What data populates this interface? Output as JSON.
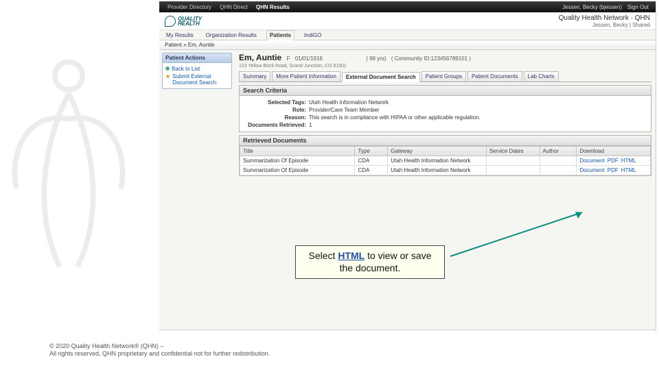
{
  "topnav": {
    "items": [
      "Provider Directory",
      "QHN Direct",
      "QHN Results"
    ],
    "active": 2,
    "user": "Jessen, Becky (bjessen)",
    "signout": "Sign Out"
  },
  "brand": {
    "logo_top": "QUALITY",
    "logo_bot": "HEALTH",
    "right_main": "Quality Health Network · QHN",
    "right_sub": "Jessen, Becky | Shared"
  },
  "tabs": {
    "items": [
      "My Results",
      "Organization Results",
      "Patients",
      "IndiGO"
    ],
    "active": 2
  },
  "breadcrumb": "Patient » Em, Auntie",
  "sidebar": {
    "title": "Patient Actions",
    "back": "Back to List",
    "submit": "Submit External Document Search"
  },
  "patient": {
    "name": "Em, Auntie",
    "sex": "F",
    "dob": "01/01/1916",
    "age": "( 99 yrs)",
    "ctx": "( Community ID:123456789101 )",
    "address": "123 Yellow Brick Road, Grand Junction, CO  81501"
  },
  "detail_tabs": [
    "Summary",
    "More Patient Information",
    "External Document Search",
    "Patient Groups",
    "Patient Documents",
    "Lab Charts"
  ],
  "detail_active": 2,
  "criteria": {
    "title": "Search Criteria",
    "tags_l": "Selected Tags:",
    "tags_v": "Utah Health Information Network",
    "role_l": "Role:",
    "role_v": "Provider/Care Team Member",
    "reason_l": "Reason:",
    "reason_v": "This search is in compliance with HIPAA or other applicable regulation.",
    "docs_l": "Documents Retrieved:",
    "docs_v": "1"
  },
  "retrieved": {
    "title": "Retrieved Documents",
    "cols": [
      "Title",
      "Type",
      "Gateway",
      "Service Dates",
      "Author",
      "Download"
    ],
    "rows": [
      {
        "title": "Summarization Of Episode",
        "type": "CDA",
        "gateway": "Utah Health Information Network",
        "dates": "",
        "author": "",
        "d1": "Document",
        "d2": "PDF",
        "d3": "HTML"
      },
      {
        "title": "Summarization Of Episode",
        "type": "CDA",
        "gateway": "Utah Health Information Network",
        "dates": "",
        "author": "",
        "d1": "Document",
        "d2": "PDF",
        "d3": "HTML"
      }
    ]
  },
  "callout": {
    "pre": "Select ",
    "bold": "HTML",
    "post": " to view or save the document."
  },
  "footer": {
    "l1": "© 2020 Quality Health Network® (QHN) –",
    "l2": "All rights reserved, QHN proprietary and confidential not for further redistribution."
  }
}
